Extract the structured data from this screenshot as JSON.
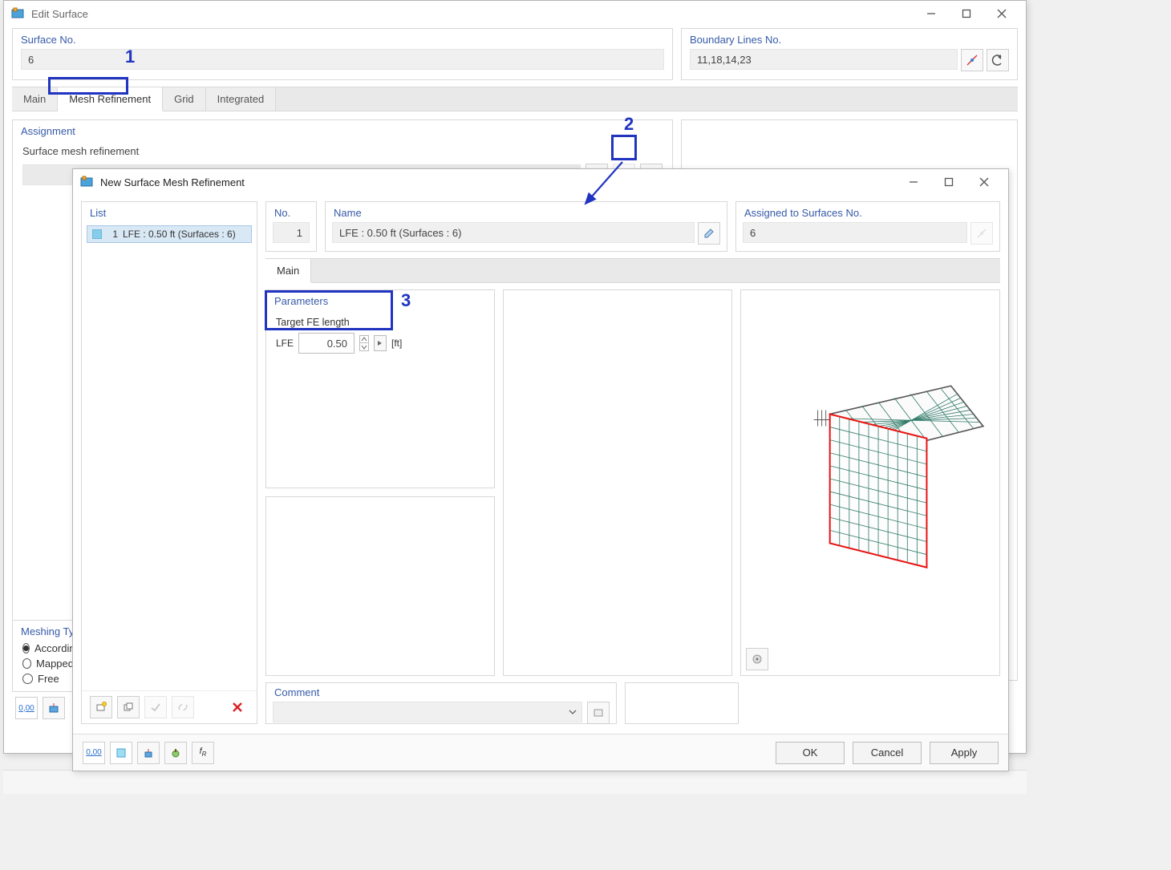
{
  "editSurface": {
    "title": "Edit Surface",
    "surfaceNoLabel": "Surface No.",
    "surfaceNoValue": "6",
    "boundaryLabel": "Boundary Lines No.",
    "boundaryValue": "11,18,14,23",
    "tabs": {
      "main": "Main",
      "meshRefinement": "Mesh Refinement",
      "grid": "Grid",
      "integrated": "Integrated"
    },
    "assignmentHeader": "Assignment",
    "assignmentLabel": "Surface mesh refinement",
    "meshingTypeHeader": "Meshing Type",
    "meshingOptions": {
      "according": "According",
      "mapped": "Mapped",
      "free": "Free"
    }
  },
  "newRefinement": {
    "title": "New Surface Mesh Refinement",
    "listHeader": "List",
    "listItem": {
      "index": "1",
      "text": "LFE : 0.50 ft (Surfaces : 6)"
    },
    "noHeader": "No.",
    "noValue": "1",
    "nameHeader": "Name",
    "nameValue": "LFE : 0.50 ft (Surfaces : 6)",
    "assignedHeader": "Assigned to Surfaces No.",
    "assignedValue": "6",
    "mainTab": "Main",
    "parametersHeader": "Parameters",
    "feLabel": "Target FE length",
    "feSymbol": "LFE",
    "feValue": "0.50",
    "feUnit": "[ft]",
    "commentHeader": "Comment",
    "buttons": {
      "ok": "OK",
      "cancel": "Cancel",
      "apply": "Apply"
    }
  },
  "annotations": {
    "one": "1",
    "two": "2",
    "three": "3"
  }
}
